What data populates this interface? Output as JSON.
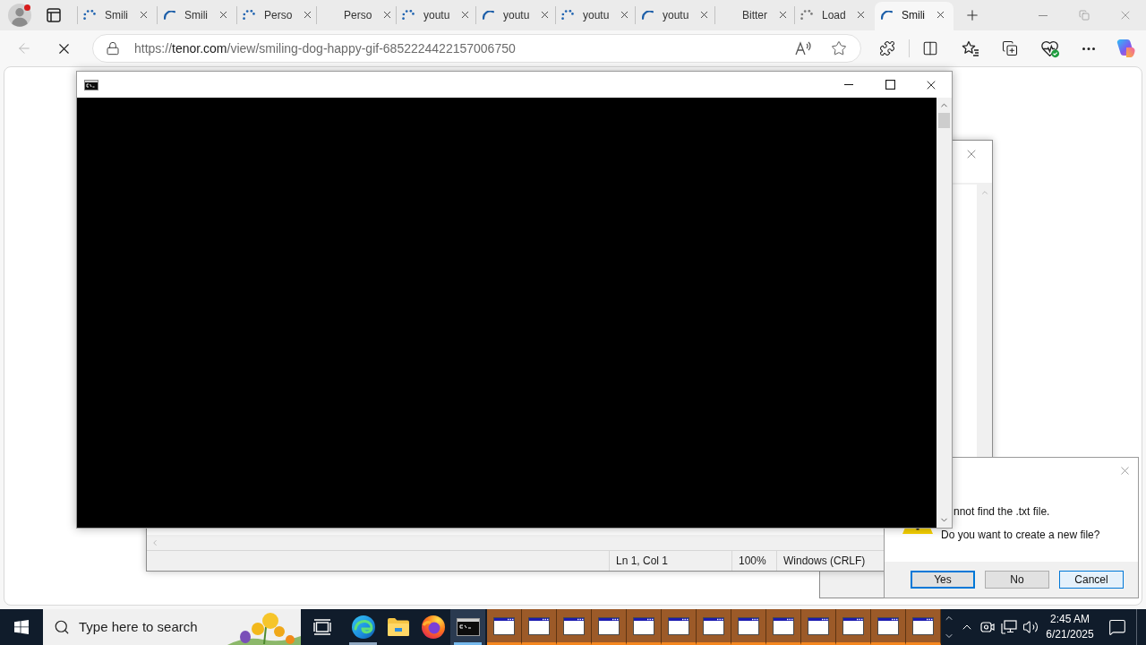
{
  "browser": {
    "profile": {
      "notification": true
    },
    "tabs": [
      {
        "title": "Smili",
        "kind": "dots",
        "selected": false
      },
      {
        "title": "Smili",
        "kind": "arc",
        "selected": false
      },
      {
        "title": "Perso",
        "kind": "dots",
        "selected": false
      },
      {
        "title": "Perso",
        "kind": "none",
        "selected": false
      },
      {
        "title": "youtu",
        "kind": "dots",
        "selected": false
      },
      {
        "title": "youtu",
        "kind": "arc",
        "selected": false
      },
      {
        "title": "youtu",
        "kind": "dots",
        "selected": false
      },
      {
        "title": "youtu",
        "kind": "arc",
        "selected": false
      },
      {
        "title": "Bitter",
        "kind": "none",
        "selected": false
      },
      {
        "title": "Load",
        "kind": "greydots",
        "selected": false
      },
      {
        "title": "Smili",
        "kind": "arc",
        "selected": true
      }
    ],
    "address_bar": {
      "scheme": "https://",
      "host": "tenor.com",
      "path": "/view/smiling-dog-happy-gif-6852224422157006750"
    }
  },
  "notepad": {
    "status_bar": [
      "Ln 1, Col 1",
      "100%",
      "Windows (CRLF)"
    ]
  },
  "dialog": {
    "message": "nnot find the .txt file.",
    "question": "Do you want to create a new file?",
    "buttons": [
      {
        "label": "Yes",
        "focused": true,
        "hovered": false
      },
      {
        "label": "No",
        "focused": false,
        "hovered": false
      },
      {
        "label": "Cancel",
        "focused": false,
        "hovered": true
      }
    ]
  },
  "taskbar": {
    "search": {
      "placeholder": "Type here to search"
    },
    "apps": [
      {
        "kind": "taskview",
        "running": false,
        "selected": false
      },
      {
        "kind": "edge",
        "running": true,
        "selected": false
      },
      {
        "kind": "explorer",
        "running": false,
        "selected": false
      },
      {
        "kind": "firefox",
        "running": false,
        "selected": false
      },
      {
        "kind": "console",
        "running": true,
        "selected": true
      }
    ],
    "window_buttons": [
      {
        "flashing": true
      },
      {
        "flashing": true
      },
      {
        "flashing": true
      },
      {
        "flashing": true
      },
      {
        "flashing": true
      },
      {
        "flashing": true
      },
      {
        "flashing": true
      },
      {
        "flashing": true
      },
      {
        "flashing": true
      },
      {
        "flashing": true
      },
      {
        "flashing": true
      },
      {
        "flashing": true
      },
      {
        "flashing": true
      }
    ],
    "clock": {
      "time": "2:45 AM",
      "date": "6/21/2025"
    }
  }
}
